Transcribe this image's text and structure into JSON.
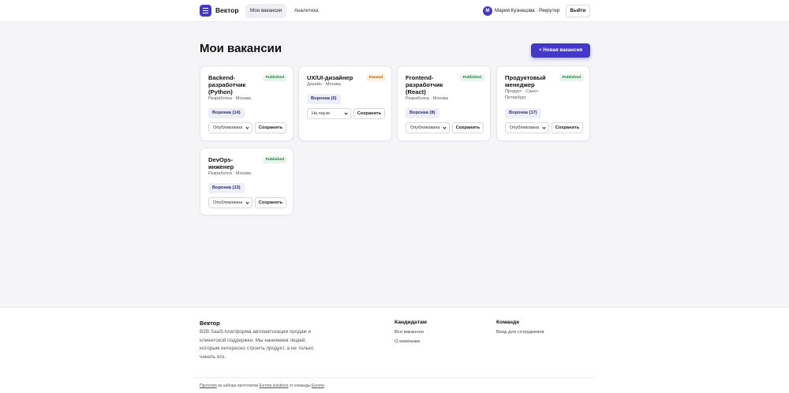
{
  "header": {
    "brand": "Вектор",
    "nav": [
      {
        "label": "Мои вакансии",
        "active": true
      },
      {
        "label": "Аналитика",
        "active": false
      }
    ],
    "user": {
      "initial": "М",
      "name": "Мария Кузнецова · Рекрутер"
    },
    "logout_label": "Выйти"
  },
  "page": {
    "title": "Мои вакансии",
    "new_button_label": "+ Новая вакансия"
  },
  "vacancies": [
    {
      "title": "Backend-разработчик (Python)",
      "status_badge": "Published",
      "meta": "Разработка · Москва",
      "funnel": "Воронка (14)",
      "select_value": "Опубликована",
      "save_label": "Сохранить"
    },
    {
      "title": "UX/UI-дизайнер",
      "status_badge": "Paused",
      "meta": "Дизайн · Москва",
      "funnel": "Воронка (0)",
      "select_value": "На паузе",
      "save_label": "Сохранить"
    },
    {
      "title": "Frontend-разработчик (React)",
      "status_badge": "Published",
      "meta": "Разработка · Москва",
      "funnel": "Воронка (8)",
      "select_value": "Опубликована",
      "save_label": "Сохранить"
    },
    {
      "title": "Продуктовый менеджер",
      "status_badge": "Published",
      "meta": "Продукт · Санкт-Петербург",
      "funnel": "Воронка (17)",
      "select_value": "Опубликована",
      "save_label": "Сохранить"
    },
    {
      "title": "DevOps-инженер",
      "status_badge": "Published",
      "meta": "Разработка · Москва",
      "funnel": "Воронка (13)",
      "select_value": "Опубликована",
      "save_label": "Сохранить"
    }
  ],
  "footer": {
    "brand": "Вектор",
    "description": "B2B SaaS-платформа автоматизации продаж и клиентской поддержки. Мы нанимаем людей, которым интересно строить продукт, а не только чинить его.",
    "candidates": {
      "title": "Кандидатам",
      "links": [
        "Все вакансии",
        "О компании"
      ]
    },
    "team": {
      "title": "Команде",
      "links": [
        "Вход для сотрудников"
      ]
    },
    "bottom": {
      "prefix": "Прототип",
      "middle": " из набора прототипов ",
      "link1": "Evrone.solutions",
      "connector": " от команды ",
      "link2": "Evrone"
    }
  },
  "colors": {
    "accent": "#4338ca",
    "published_bg": "#e8f5ec",
    "published_text": "#1e7b3c",
    "paused_bg": "#fff1e3",
    "paused_text": "#b25a10"
  }
}
